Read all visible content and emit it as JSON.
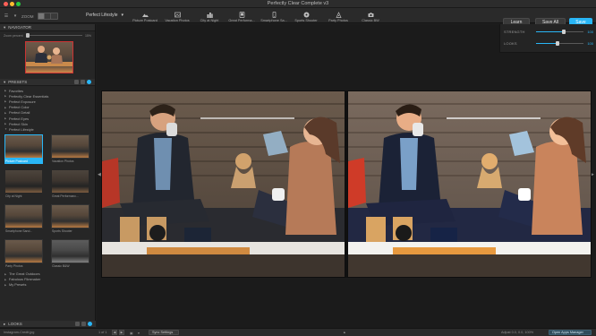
{
  "window": {
    "title": "Perfectly Clear Complete v3"
  },
  "toolbar": {
    "zoom_label": "ZOOM",
    "preset_selected": "Perfect Lifestyle",
    "preset_strip": [
      {
        "label": "Picture Postcard",
        "icon": "mountain-icon",
        "active": true
      },
      {
        "label": "Vacation Photos",
        "icon": "landscape-icon",
        "active": false
      },
      {
        "label": "City at Night",
        "icon": "city-icon",
        "active": false
      },
      {
        "label": "Great Performa...",
        "icon": "performance-icon",
        "active": false
      },
      {
        "label": "Smartphone Sa...",
        "icon": "smartphone-icon",
        "active": false
      },
      {
        "label": "Sports Shooter",
        "icon": "soccer-ball-icon",
        "active": false
      },
      {
        "label": "Party Photos",
        "icon": "party-icon",
        "active": false
      },
      {
        "label": "Classic BW",
        "icon": "camera-icon",
        "active": false
      }
    ],
    "learn_label": "Learn",
    "saveall_label": "Save All",
    "save_label": "Save"
  },
  "navigator": {
    "title": "NAVIGATOR",
    "zoom_label": "Zoom percent",
    "zoom_value": "15%"
  },
  "presets": {
    "title": "PRESETS",
    "tree_top": [
      "Favorites",
      "Perfectly Clear Essentials",
      "Perfect Exposure",
      "Perfect Color",
      "Perfect Detail",
      "Perfect Eyes",
      "Perfect Skin",
      "Perfect Lifestyle"
    ],
    "grid": [
      {
        "label": "Picture Postcard",
        "selected": true,
        "style": "normal"
      },
      {
        "label": "Vacation Photos",
        "selected": false,
        "style": "normal"
      },
      {
        "label": "City at Night",
        "selected": false,
        "style": "dark"
      },
      {
        "label": "Great Performanc...",
        "selected": false,
        "style": "dark"
      },
      {
        "label": "Smartphone Sand...",
        "selected": false,
        "style": "normal"
      },
      {
        "label": "Sports Shooter",
        "selected": false,
        "style": "normal"
      },
      {
        "label": "Party Photos",
        "selected": false,
        "style": "normal"
      },
      {
        "label": "Classic B&W",
        "selected": false,
        "style": "bw"
      }
    ],
    "tree_bottom": [
      "The Great Outdoors",
      "Fabulous Filmmaker",
      "My Presets"
    ]
  },
  "looks": {
    "title": "LOOKS"
  },
  "adjust": {
    "strength_label": "STRENGTH",
    "strength_value": "100",
    "strength_level": 0.58,
    "looks_label": "LOOKS",
    "looks_value": "100",
    "looks_level": 0.46
  },
  "statusbar": {
    "filename": "Instagram-Credit.jpg",
    "counter": "1 of 1",
    "sync_label": "Sync Settings",
    "info": "Adjust 0.0, 0.0, 100%",
    "apps_label": "Open Apps Manager"
  },
  "colors": {
    "accent": "#29b6f6",
    "close": "#ff5f57",
    "minimize": "#febc2e",
    "maximize": "#28c840"
  }
}
